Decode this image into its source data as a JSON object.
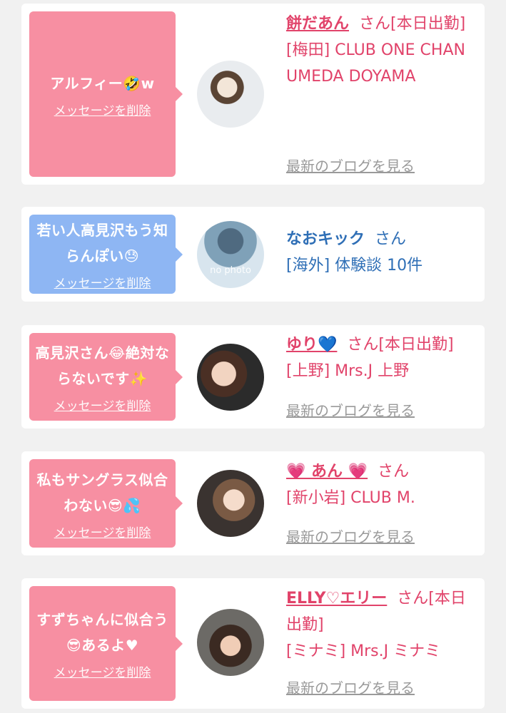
{
  "colors": {
    "pink_bubble": "#f78fa2",
    "blue_bubble": "#8eb6f3",
    "pink_text": "#e1436a",
    "blue_text": "#2f6fb6",
    "blog_link": "#9a9a9a"
  },
  "entries": [
    {
      "message": "アルフィー🤣w",
      "delete_label": "メッセージを削除",
      "avatar": "avatar-photo",
      "name": "餅だあん",
      "suffix": "さん[本日出勤]",
      "shop": "[梅田] CLUB ONE CHAN UMEDA DOYAMA",
      "blog_label": "最新のブログを見る"
    },
    {
      "message": "若い人高見沢もう知らんぽい😓",
      "delete_label": "メッセージを削除",
      "avatar": "no-photo",
      "nophoto_text": "no photo",
      "name": "なおキック",
      "suffix": "さん",
      "shop": "[海外] 体験談 10件"
    },
    {
      "message": "高見沢さん😂絶対ならないです✨",
      "delete_label": "メッセージを削除",
      "avatar": "avatar-photo",
      "name": "ゆり💙",
      "suffix": "さん[本日出勤]",
      "shop": "[上野] Mrs.J 上野",
      "blog_label": "最新のブログを見る"
    },
    {
      "message": "私もサングラス似合わない😎💦",
      "delete_label": "メッセージを削除",
      "avatar": "avatar-photo",
      "name": "💗 あん 💗",
      "suffix": "さん",
      "shop": "[新小岩] CLUB M.",
      "blog_label": "最新のブログを見る"
    },
    {
      "message": "すずちゃんに似合う😎あるよ♥",
      "delete_label": "メッセージを削除",
      "avatar": "avatar-photo",
      "name": "ELLY♡エリー",
      "suffix": "さん[本日出勤]",
      "shop": "[ミナミ] Mrs.J ミナミ",
      "blog_label": "最新のブログを見る"
    }
  ]
}
